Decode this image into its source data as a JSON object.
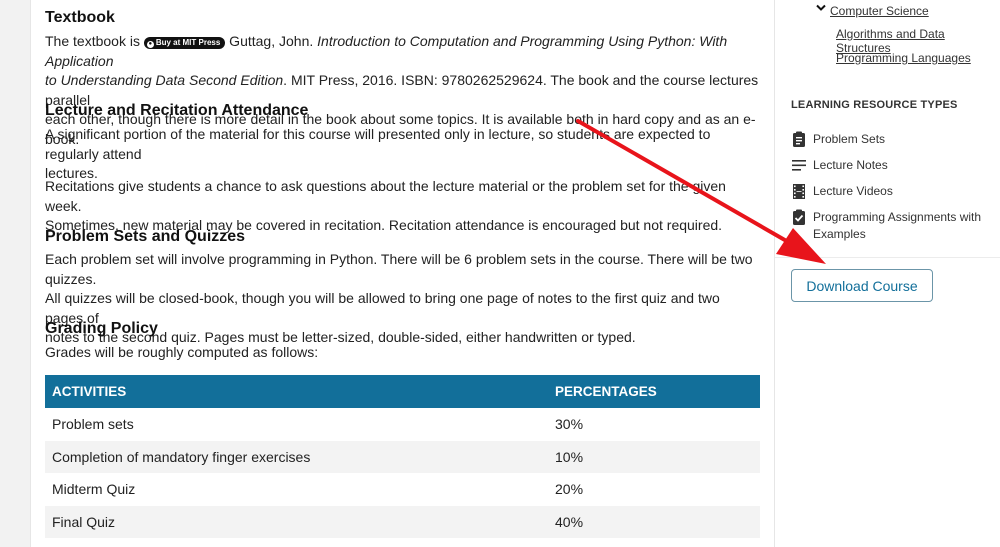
{
  "main": {
    "textbook": {
      "heading": "Textbook",
      "intro": "The textbook is ",
      "badge": "Buy at MIT Press",
      "author": " Guttag, John. ",
      "title_line1": "Introduction to Computation and Programming Using Python: With Application",
      "title_line2": "to Understanding Data Second Edition",
      "after_title": ". MIT Press, 2016. ISBN: 9780262529624. The book and the course lectures parallel",
      "line3": "each other, though there is more detail in the book about some topics. It is available both in hard copy and as an e-book."
    },
    "attendance": {
      "heading": "Lecture and Recitation Attendance",
      "p1_line1": "A significant portion of the material for this course will presented only in lecture, so students are expected to regularly attend",
      "p1_line2": "lectures.",
      "p2_line1": "Recitations give students a chance to ask questions about the lecture material or the problem set for the given week.",
      "p2_line2": "Sometimes, new material may be covered in recitation. Recitation attendance is encouraged but not required."
    },
    "problem_sets": {
      "heading": "Problem Sets and Quizzes",
      "line1": "Each problem set will involve programming in Python. There will be 6 problem sets in the course. There will be two quizzes.",
      "line2": "All quizzes will be closed-book, though you will be allowed to bring one page of notes to the first quiz and two pages of",
      "line3": "notes to the second quiz. Pages must be letter-sized, double-sided, either handwritten or typed."
    },
    "grading": {
      "heading": "Grading Policy",
      "intro": "Grades will be roughly computed as follows:",
      "columns": [
        "ACTIVITIES",
        "PERCENTAGES"
      ],
      "rows": [
        {
          "activity": "Problem sets",
          "percentage": "30%"
        },
        {
          "activity": "Completion of mandatory finger exercises",
          "percentage": "10%"
        },
        {
          "activity": "Midterm Quiz",
          "percentage": "20%"
        },
        {
          "activity": "Final Quiz",
          "percentage": "40%"
        }
      ]
    }
  },
  "sidebar": {
    "topic_parent": "Computer Science",
    "topic_children": [
      "Algorithms and Data Structures",
      "Programming Languages"
    ],
    "resource_types_title": "LEARNING RESOURCE TYPES",
    "resources": [
      {
        "label": "Problem Sets",
        "icon": "clipboard-list-icon"
      },
      {
        "label": "Lecture Notes",
        "icon": "lines-icon"
      },
      {
        "label": "Lecture Videos",
        "icon": "film-icon"
      },
      {
        "label": "Programming Assignments with Examples",
        "icon": "clipboard-check-icon"
      }
    ],
    "download_label": "Download Course"
  },
  "colors": {
    "table_header": "#126f9a",
    "button_text": "#126f9a",
    "annotation_arrow": "#e8141b"
  }
}
